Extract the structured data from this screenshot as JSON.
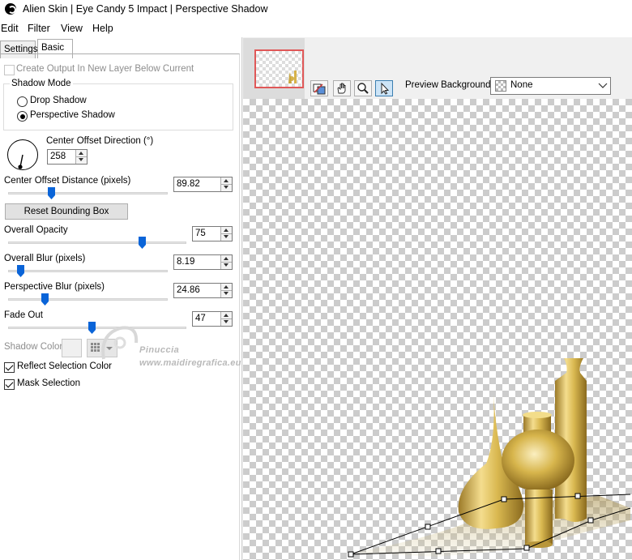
{
  "window": {
    "title": "Alien Skin | Eye Candy 5 Impact | Perspective Shadow"
  },
  "menu": [
    "Edit",
    "Filter",
    "View",
    "Help"
  ],
  "tabs": [
    {
      "label": "Settings"
    },
    {
      "label": "Basic"
    }
  ],
  "basic": {
    "create_output_label": "Create Output In New Layer Below Current",
    "shadow_mode": {
      "title": "Shadow Mode",
      "options": [
        "Drop Shadow",
        "Perspective Shadow"
      ],
      "selected": "Perspective Shadow"
    },
    "center_offset_direction": {
      "label": "Center Offset Direction (°)",
      "value": "258"
    },
    "center_offset_distance": {
      "label": "Center Offset Distance (pixels)",
      "value": "89.82",
      "slider_fraction": 0.27
    },
    "reset_button": "Reset Bounding Box",
    "overall_opacity": {
      "label": "Overall Opacity",
      "value": "75",
      "slider_fraction": 0.75
    },
    "overall_blur": {
      "label": "Overall Blur (pixels)",
      "value": "8.19",
      "slider_fraction": 0.08
    },
    "perspective_blur": {
      "label": "Perspective Blur (pixels)",
      "value": "24.86",
      "slider_fraction": 0.23
    },
    "fade_out": {
      "label": "Fade Out",
      "value": "47",
      "slider_fraction": 0.47
    },
    "shadow_color_label": "Shadow Color",
    "reflect_selection_color": {
      "label": "Reflect Selection Color",
      "checked": true
    },
    "mask_selection": {
      "label": "Mask Selection",
      "checked": true
    }
  },
  "preview": {
    "background_label": "Preview Background:",
    "background_value": "None",
    "tools": [
      "preview-toggle-icon",
      "hand-icon",
      "zoom-icon",
      "arrow-pointer-icon"
    ]
  },
  "watermark": {
    "line1": "Pinuccia",
    "line2": "www.maidiregrafica.eu"
  },
  "colors": {
    "slider_thumb": "#0a64d8",
    "thumbnail_border": "#e05858",
    "gold": "#d6b24a"
  }
}
